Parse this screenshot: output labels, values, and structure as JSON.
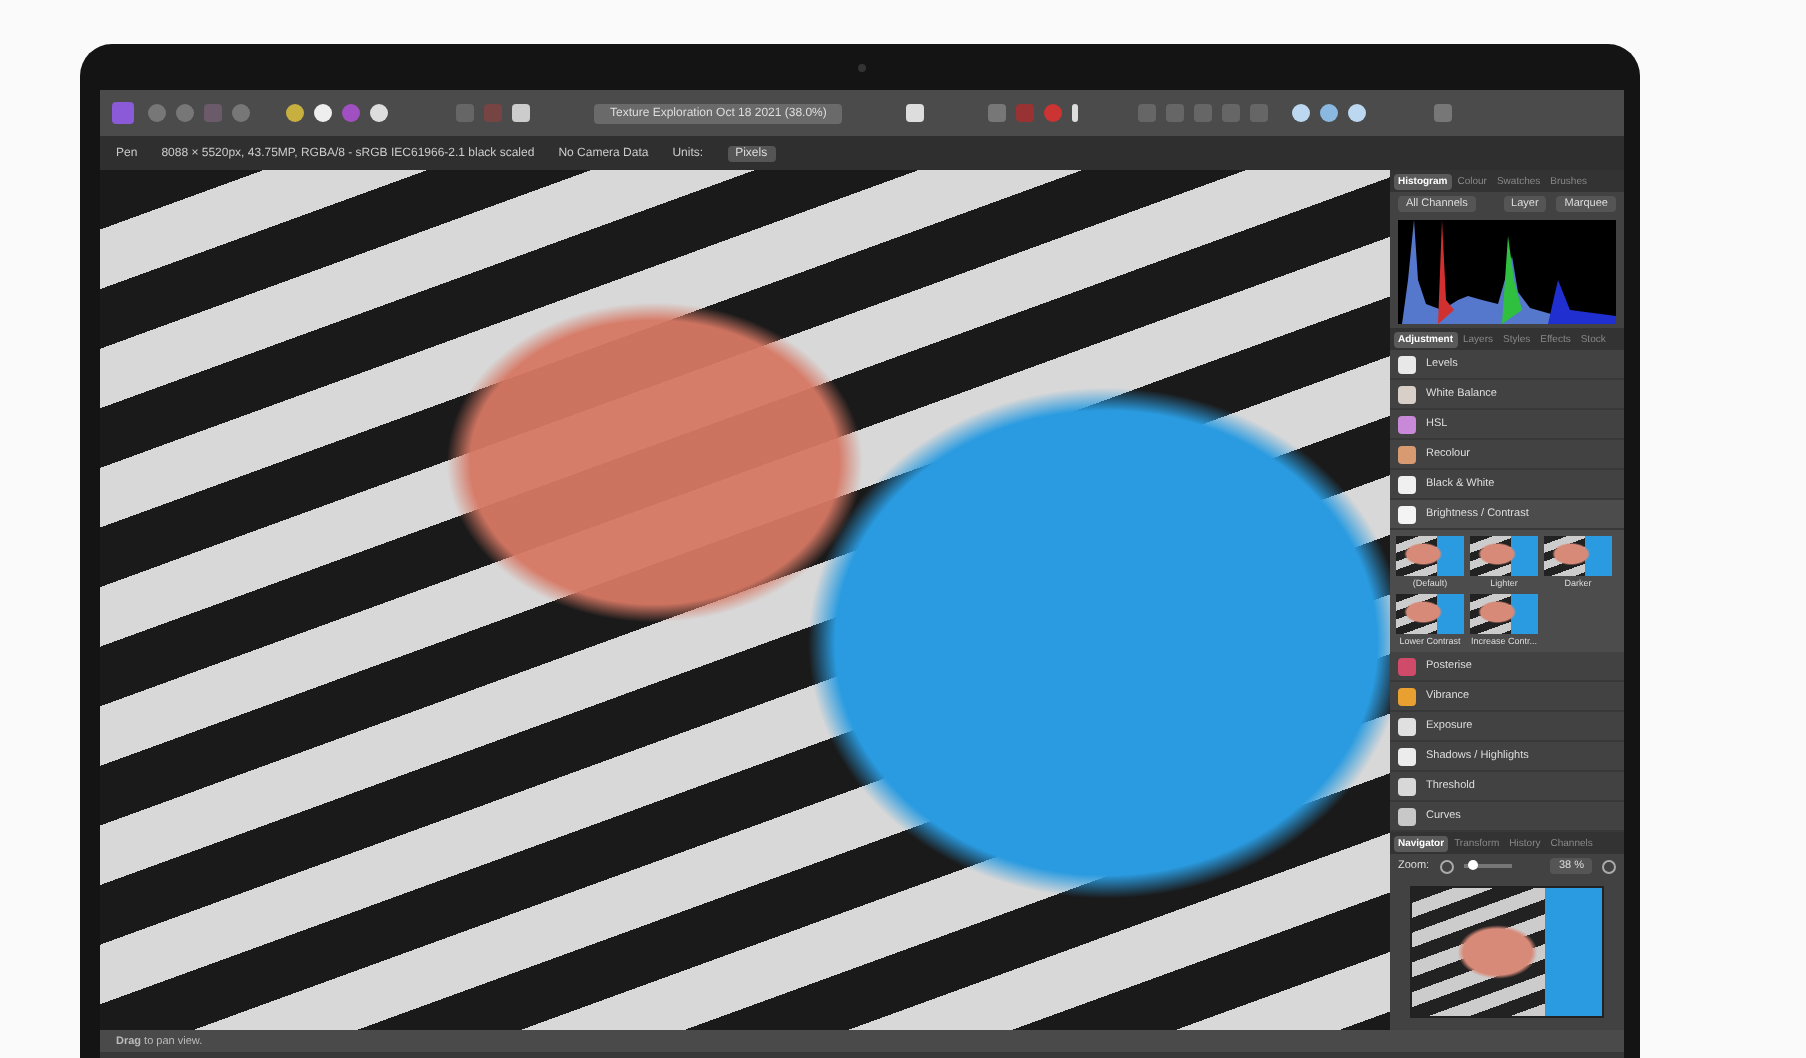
{
  "toolbar": {
    "document_title": "Texture Exploration Oct 18 2021 (38.0%)"
  },
  "context_bar": {
    "tool": "Pen",
    "info": "8088 × 5520px, 43.75MP, RGBA/8 - sRGB IEC61966-2.1 black scaled",
    "camera": "No Camera Data",
    "units_label": "Units:",
    "units_value": "Pixels"
  },
  "studio_top": {
    "tabs": [
      {
        "label": "Histogram",
        "selected": true
      },
      {
        "label": "Colour",
        "selected": false
      },
      {
        "label": "Swatches",
        "selected": false
      },
      {
        "label": "Brushes",
        "selected": false
      }
    ],
    "channel": "All Channels",
    "buttons": [
      "Layer",
      "Marquee"
    ]
  },
  "studio_middle": {
    "tabs": [
      {
        "label": "Adjustment",
        "selected": true
      },
      {
        "label": "Layers",
        "selected": false
      },
      {
        "label": "Styles",
        "selected": false
      },
      {
        "label": "Effects",
        "selected": false
      },
      {
        "label": "Stock",
        "selected": false
      }
    ],
    "items": [
      {
        "label": "Levels",
        "color": "#e8e8e8"
      },
      {
        "label": "White Balance",
        "color": "#d8d0c8"
      },
      {
        "label": "HSL",
        "color": "#c88ad8"
      },
      {
        "label": "Recolour",
        "color": "#d89a70"
      },
      {
        "label": "Black & White",
        "color": "#f0f0f0"
      },
      {
        "label": "Brightness / Contrast",
        "color": "#f4f4f4",
        "presets": [
          "(Default)",
          "Lighter",
          "Darker",
          "Lower Contrast",
          "Increase Contr..."
        ]
      },
      {
        "label": "Posterise",
        "color": "#d04a6a"
      },
      {
        "label": "Vibrance",
        "color": "#e8a030"
      },
      {
        "label": "Exposure",
        "color": "#e0e0e0"
      },
      {
        "label": "Shadows / Highlights",
        "color": "#ececec"
      },
      {
        "label": "Threshold",
        "color": "#d8d8d8"
      },
      {
        "label": "Curves",
        "color": "#c8c8c8"
      }
    ]
  },
  "studio_bottom": {
    "tabs": [
      {
        "label": "Navigator",
        "selected": true
      },
      {
        "label": "Transform",
        "selected": false
      },
      {
        "label": "History",
        "selected": false
      },
      {
        "label": "Channels",
        "selected": false
      }
    ],
    "zoom_label": "Zoom:",
    "level": 0.2,
    "zoom_value": "38 %"
  },
  "status_bar": "**Drag** to pan view."
}
